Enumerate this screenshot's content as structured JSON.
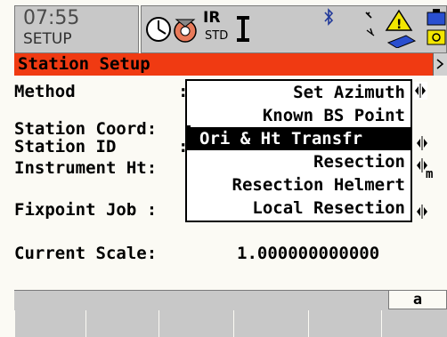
{
  "status": {
    "time": "07:55",
    "mode": "SETUP",
    "measure_label": "IR",
    "measure_sub": "STD",
    "icons": [
      "clock-icon",
      "target-prism-icon",
      "instrument-icon",
      "bluetooth-icon",
      "signal-icon",
      "warning-icon",
      "battery-icon"
    ]
  },
  "title": "Station Setup",
  "fields": {
    "method_label": "Method",
    "station_coord_label": "Station Coord:",
    "station_id_label": "Station ID",
    "instrument_ht_label": "Instrument Ht:",
    "instrument_ht_unit": "m",
    "fixpoint_job_label": "Fixpoint Job :",
    "current_scale_label": "Current Scale:",
    "current_scale_value": "1.000000000000"
  },
  "method_options": [
    "Set Azimuth",
    "Known BS Point",
    "Ori & Ht Transfr",
    "Resection",
    "Resection Helmert",
    "Local Resection"
  ],
  "selected_option": "Ori & Ht Transfr",
  "softkeys": {
    "tab_label": "a",
    "keys": [
      "",
      "",
      "",
      "",
      "",
      ""
    ]
  },
  "colors": {
    "title_bar": "#f03a12",
    "background": "#fbfaf4",
    "status_gray": "#c8c8c8"
  }
}
